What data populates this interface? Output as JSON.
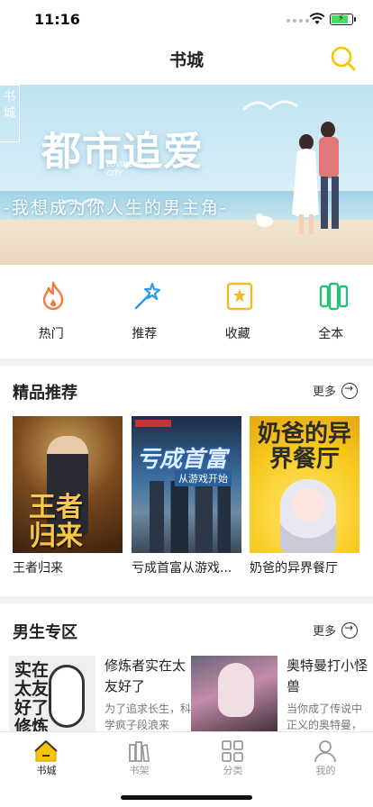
{
  "status": {
    "time": "11:16"
  },
  "nav": {
    "title": "书城"
  },
  "banner": {
    "corner_text": "书城",
    "title": "都市追爱",
    "subtitle_en": "LOVING IN THE CITY",
    "slogan": "-我想成为你人生的男主角-"
  },
  "quick_menu": [
    {
      "label": "热门",
      "icon": "flame-icon",
      "color": "#f07a3a"
    },
    {
      "label": "推荐",
      "icon": "magic-wand-icon",
      "color": "#2f9be8"
    },
    {
      "label": "收藏",
      "icon": "star-icon",
      "color": "#f2b92a"
    },
    {
      "label": "全本",
      "icon": "book-stack-icon",
      "color": "#27c07a"
    }
  ],
  "featured": {
    "title": "精品推荐",
    "more_label": "更多",
    "books": [
      {
        "title": "王者归来",
        "cover_text": "王者归来"
      },
      {
        "title": "亏成首富从游戏...",
        "cover_text": "亏成首富",
        "cover_subtitle": "从游戏开始"
      },
      {
        "title": "奶爸的异界餐厅",
        "cover_text": "奶爸的异界餐厅"
      }
    ]
  },
  "male": {
    "title": "男生专区",
    "more_label": "更多",
    "books": [
      {
        "title": "修炼者实在太友好了",
        "desc": "为了追求长生，科学疯子段浪来",
        "cover_text": "实在太友好了 修炼者"
      },
      {
        "title": "奥特曼打小怪兽",
        "desc": "当你成了传说中正义的奥特曼，"
      }
    ]
  },
  "tabs": [
    {
      "label": "书城",
      "icon": "home-icon",
      "active": true
    },
    {
      "label": "书架",
      "icon": "bookshelf-icon",
      "active": false
    },
    {
      "label": "分类",
      "icon": "grid-icon",
      "active": false
    },
    {
      "label": "我的",
      "icon": "user-icon",
      "active": false
    }
  ],
  "colors": {
    "accent": "#f7c600",
    "text": "#222222",
    "muted": "#999999"
  }
}
